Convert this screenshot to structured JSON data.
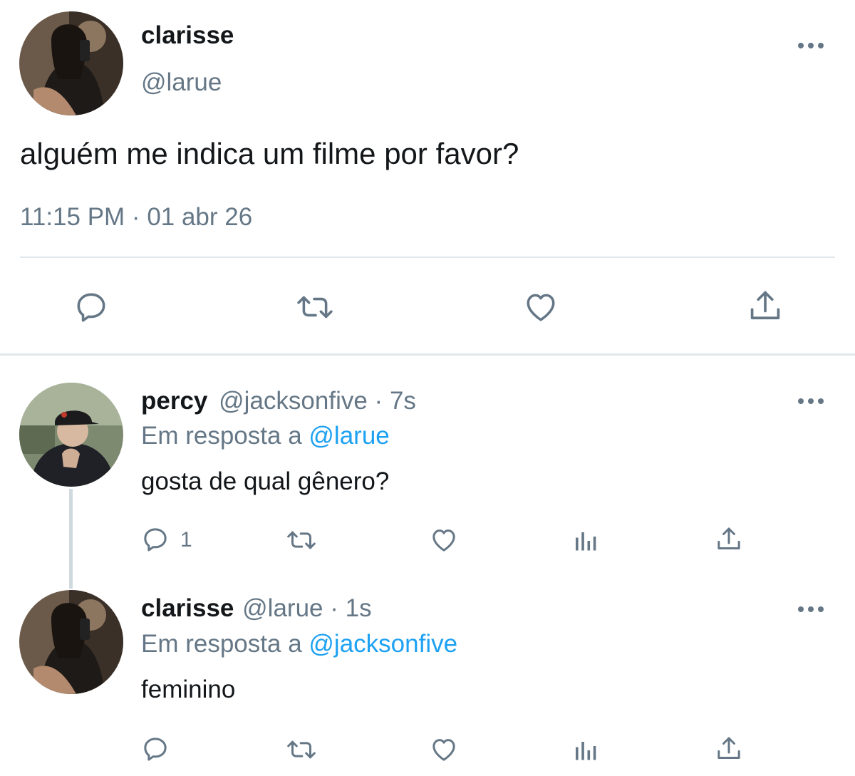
{
  "main_tweet": {
    "display_name": "clarisse",
    "handle": "@larue",
    "text": "alguém me indica um filme por favor?",
    "timestamp": "11:15 PM · 01 abr 26",
    "actions": [
      "reply-icon",
      "retweet-icon",
      "like-icon",
      "share-icon"
    ]
  },
  "replies": [
    {
      "display_name": "percy",
      "handle": "@jacksonfive",
      "sep": "·",
      "time": "7s",
      "reply_prefix": "Em resposta a",
      "reply_to": "@larue",
      "text": "gosta de qual gênero?",
      "reply_count": "1",
      "actions": [
        "reply-icon",
        "retweet-icon",
        "like-icon",
        "analytics-icon",
        "share-icon"
      ]
    },
    {
      "display_name": "clarisse",
      "handle": "@larue",
      "sep": "·",
      "time": "1s",
      "reply_prefix": "Em resposta a",
      "reply_to": "@jacksonfive",
      "text": "feminino",
      "reply_count": "",
      "actions": [
        "reply-icon",
        "retweet-icon",
        "like-icon",
        "analytics-icon",
        "share-icon"
      ]
    }
  ],
  "colors": {
    "text": "#14171a",
    "muted": "#657786",
    "link": "#1da1f2",
    "divider": "#e1e8ed"
  }
}
